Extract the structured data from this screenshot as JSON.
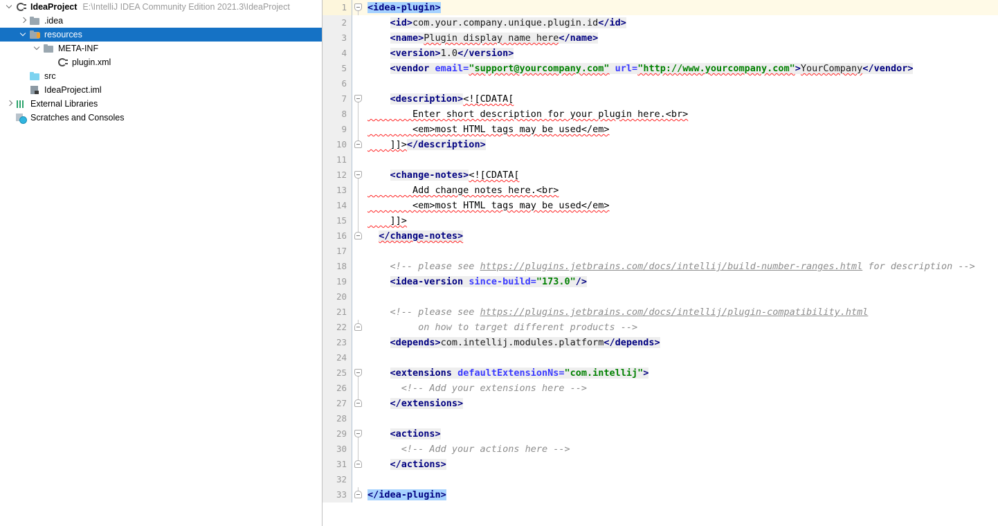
{
  "window": {
    "ide": "IntelliJ IDEA Community Edition 2021.3",
    "open_file": "plugin.xml"
  },
  "project_tree": {
    "items": [
      {
        "label": "IdeaProject",
        "sublabel": "E:\\IntelliJ IDEA Community Edition 2021.3\\IdeaProject",
        "icon": "plugin-module-icon",
        "depth": 0,
        "arrow": "expanded",
        "bold": true,
        "selected": false
      },
      {
        "label": ".idea",
        "sublabel": "",
        "icon": "folder-icon",
        "depth": 1,
        "arrow": "collapsed",
        "bold": false,
        "selected": false
      },
      {
        "label": "resources",
        "sublabel": "",
        "icon": "resources-folder-icon",
        "depth": 1,
        "arrow": "expanded",
        "bold": false,
        "selected": true
      },
      {
        "label": "META-INF",
        "sublabel": "",
        "icon": "folder-icon",
        "depth": 2,
        "arrow": "expanded",
        "bold": false,
        "selected": false
      },
      {
        "label": "plugin.xml",
        "sublabel": "",
        "icon": "plugin-xml-icon",
        "depth": 3,
        "arrow": "none",
        "bold": false,
        "selected": false
      },
      {
        "label": "src",
        "sublabel": "",
        "icon": "source-folder-icon",
        "depth": 1,
        "arrow": "none",
        "bold": false,
        "selected": false
      },
      {
        "label": "IdeaProject.iml",
        "sublabel": "",
        "icon": "module-file-icon",
        "depth": 1,
        "arrow": "none",
        "bold": false,
        "selected": false
      },
      {
        "label": "External Libraries",
        "sublabel": "",
        "icon": "libraries-icon",
        "depth": 0,
        "arrow": "collapsed",
        "bold": false,
        "selected": false
      },
      {
        "label": "Scratches and Consoles",
        "sublabel": "",
        "icon": "scratches-icon",
        "depth": 0,
        "arrow": "none",
        "bold": false,
        "selected": false
      }
    ]
  },
  "editor": {
    "language": "XML",
    "caret_line": 1,
    "total_lines": 33,
    "colors": {
      "tag_name": "#000080",
      "attribute_name": "#3a3aff",
      "attribute_value": "#008000",
      "comment": "#8c8c8c",
      "selection": "#a6d2ff",
      "caret_row": "#fffae7",
      "gutter_bg": "#efefef",
      "spellcheck_squiggle": "#ff2222",
      "tree_selection": "#1572c5"
    },
    "lines": [
      {
        "n": 1,
        "fold": "open",
        "caret": true,
        "tokens": [
          {
            "t": "&lt;idea-plugin&gt;",
            "c": "t-tag sel"
          }
        ]
      },
      {
        "n": 2,
        "fold": "none",
        "caret": false,
        "tokens": [
          {
            "t": "    ",
            "c": ""
          },
          {
            "t": "&lt;id&gt;",
            "c": "t-tag tagbg"
          },
          {
            "t": "com.your.company.unique.plugin.id",
            "c": "t-text tagbg"
          },
          {
            "t": "&lt;/id&gt;",
            "c": "t-tag tagbg"
          }
        ]
      },
      {
        "n": 3,
        "fold": "none",
        "caret": false,
        "tokens": [
          {
            "t": "    ",
            "c": ""
          },
          {
            "t": "&lt;name&gt;",
            "c": "t-tag tagbg"
          },
          {
            "t": "Plugin display name here",
            "c": "t-text tagbg sq"
          },
          {
            "t": "&lt;/name&gt;",
            "c": "t-tag tagbg"
          }
        ]
      },
      {
        "n": 4,
        "fold": "none",
        "caret": false,
        "tokens": [
          {
            "t": "    ",
            "c": ""
          },
          {
            "t": "&lt;version&gt;",
            "c": "t-tag tagbg"
          },
          {
            "t": "1.0",
            "c": "t-text tagbg"
          },
          {
            "t": "&lt;/version&gt;",
            "c": "t-tag tagbg"
          }
        ]
      },
      {
        "n": 5,
        "fold": "none",
        "caret": false,
        "tokens": [
          {
            "t": "    ",
            "c": ""
          },
          {
            "t": "&lt;vendor ",
            "c": "t-tag tagbg"
          },
          {
            "t": "email=",
            "c": "t-attr tagbg"
          },
          {
            "t": "\"support@yourcompany.com\"",
            "c": "t-val tagbg sq"
          },
          {
            "t": " ",
            "c": "tagbg"
          },
          {
            "t": "url=",
            "c": "t-attr tagbg"
          },
          {
            "t": "\"http://www.yourcompany.com\"",
            "c": "t-val tagbg sq"
          },
          {
            "t": "&gt;",
            "c": "t-tag tagbg"
          },
          {
            "t": "YourCompany",
            "c": "t-text tagbg sq"
          },
          {
            "t": "&lt;/vendor&gt;",
            "c": "t-tag tagbg"
          }
        ]
      },
      {
        "n": 6,
        "fold": "none",
        "caret": false,
        "tokens": []
      },
      {
        "n": 7,
        "fold": "open",
        "caret": false,
        "tokens": [
          {
            "t": "    ",
            "c": ""
          },
          {
            "t": "&lt;description&gt;",
            "c": "t-tag tagbg"
          },
          {
            "t": "&lt;![CDATA[",
            "c": "t-cdata sq"
          }
        ]
      },
      {
        "n": 8,
        "fold": "line",
        "caret": false,
        "tokens": [
          {
            "t": "        Enter short description for your plugin here.&lt;br&gt;",
            "c": "t-cdata sq"
          }
        ]
      },
      {
        "n": 9,
        "fold": "line",
        "caret": false,
        "tokens": [
          {
            "t": "        &lt;em&gt;most HTML tags may be used&lt;/em&gt;",
            "c": "t-cdata sq"
          }
        ]
      },
      {
        "n": 10,
        "fold": "end",
        "caret": false,
        "tokens": [
          {
            "t": "    ]]&gt;",
            "c": "t-cdata sq"
          },
          {
            "t": "&lt;/description&gt;",
            "c": "t-tag tagbg"
          }
        ]
      },
      {
        "n": 11,
        "fold": "none",
        "caret": false,
        "tokens": []
      },
      {
        "n": 12,
        "fold": "open",
        "caret": false,
        "tokens": [
          {
            "t": "    ",
            "c": ""
          },
          {
            "t": "&lt;change-notes&gt;",
            "c": "t-tag tagbg"
          },
          {
            "t": "&lt;![CDATA[",
            "c": "t-cdata sq"
          }
        ]
      },
      {
        "n": 13,
        "fold": "line",
        "caret": false,
        "tokens": [
          {
            "t": "        Add change notes here.&lt;br&gt;",
            "c": "t-cdata sq"
          }
        ]
      },
      {
        "n": 14,
        "fold": "line",
        "caret": false,
        "tokens": [
          {
            "t": "        &lt;em&gt;most HTML tags may be used&lt;/em&gt;",
            "c": "t-cdata sq"
          }
        ]
      },
      {
        "n": 15,
        "fold": "line",
        "caret": false,
        "tokens": [
          {
            "t": "    ]]&gt;",
            "c": "t-cdata sq"
          }
        ]
      },
      {
        "n": 16,
        "fold": "end",
        "caret": false,
        "tokens": [
          {
            "t": "  ",
            "c": ""
          },
          {
            "t": "&lt;/change-notes&gt;",
            "c": "t-tag tagbg sq"
          }
        ]
      },
      {
        "n": 17,
        "fold": "none",
        "caret": false,
        "tokens": []
      },
      {
        "n": 18,
        "fold": "none",
        "caret": false,
        "tokens": [
          {
            "t": "    &lt;!-- please see ",
            "c": "t-com"
          },
          {
            "t": "https://plugins.jetbrains.com/docs/intellij/build-number-ranges.html",
            "c": "t-com link"
          },
          {
            "t": " for description --&gt;",
            "c": "t-com"
          }
        ]
      },
      {
        "n": 19,
        "fold": "none",
        "caret": false,
        "tokens": [
          {
            "t": "    ",
            "c": ""
          },
          {
            "t": "&lt;idea-version ",
            "c": "t-tag tagbg"
          },
          {
            "t": "since-build=",
            "c": "t-attr tagbg"
          },
          {
            "t": "\"173.0\"",
            "c": "t-val tagbg"
          },
          {
            "t": "/&gt;",
            "c": "t-tag tagbg"
          }
        ]
      },
      {
        "n": 20,
        "fold": "none",
        "caret": false,
        "tokens": []
      },
      {
        "n": 21,
        "fold": "none",
        "caret": false,
        "tokens": [
          {
            "t": "    &lt;!-- please see ",
            "c": "t-com"
          },
          {
            "t": "https://plugins.jetbrains.com/docs/intellij/plugin-compatibility.html",
            "c": "t-com link"
          }
        ]
      },
      {
        "n": 22,
        "fold": "end",
        "caret": false,
        "tokens": [
          {
            "t": "         on how to target different products --&gt;",
            "c": "t-com"
          }
        ]
      },
      {
        "n": 23,
        "fold": "none",
        "caret": false,
        "tokens": [
          {
            "t": "    ",
            "c": ""
          },
          {
            "t": "&lt;depends&gt;",
            "c": "t-tag tagbg"
          },
          {
            "t": "com.intellij.modules.platform",
            "c": "t-text tagbg"
          },
          {
            "t": "&lt;/depends&gt;",
            "c": "t-tag tagbg"
          }
        ]
      },
      {
        "n": 24,
        "fold": "none",
        "caret": false,
        "tokens": []
      },
      {
        "n": 25,
        "fold": "open",
        "caret": false,
        "tokens": [
          {
            "t": "    ",
            "c": ""
          },
          {
            "t": "&lt;extensions ",
            "c": "t-tag tagbg"
          },
          {
            "t": "defaultExtensionNs=",
            "c": "t-attr tagbg"
          },
          {
            "t": "\"com.intellij\"",
            "c": "t-val tagbg"
          },
          {
            "t": "&gt;",
            "c": "t-tag tagbg"
          }
        ]
      },
      {
        "n": 26,
        "fold": "line",
        "caret": false,
        "tokens": [
          {
            "t": "      &lt;!-- Add your extensions here --&gt;",
            "c": "t-com"
          }
        ]
      },
      {
        "n": 27,
        "fold": "end",
        "caret": false,
        "tokens": [
          {
            "t": "    ",
            "c": ""
          },
          {
            "t": "&lt;/extensions&gt;",
            "c": "t-tag tagbg"
          }
        ]
      },
      {
        "n": 28,
        "fold": "none",
        "caret": false,
        "tokens": []
      },
      {
        "n": 29,
        "fold": "open",
        "caret": false,
        "tokens": [
          {
            "t": "    ",
            "c": ""
          },
          {
            "t": "&lt;actions&gt;",
            "c": "t-tag tagbg"
          }
        ]
      },
      {
        "n": 30,
        "fold": "line",
        "caret": false,
        "tokens": [
          {
            "t": "      &lt;!-- Add your actions here --&gt;",
            "c": "t-com"
          }
        ]
      },
      {
        "n": 31,
        "fold": "end",
        "caret": false,
        "tokens": [
          {
            "t": "    ",
            "c": ""
          },
          {
            "t": "&lt;/actions&gt;",
            "c": "t-tag tagbg"
          }
        ]
      },
      {
        "n": 32,
        "fold": "none",
        "caret": false,
        "tokens": []
      },
      {
        "n": 33,
        "fold": "end",
        "caret": false,
        "tokens": [
          {
            "t": "&lt;/idea-plugin&gt;",
            "c": "t-tag sel"
          }
        ]
      }
    ]
  }
}
